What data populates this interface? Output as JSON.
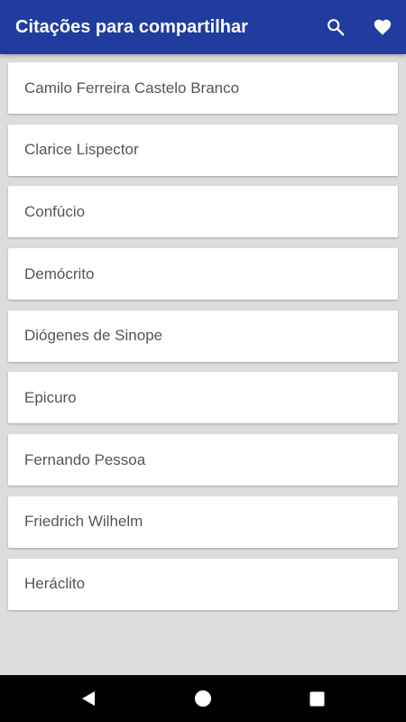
{
  "app_bar": {
    "title": "Citações para compartilhar",
    "background_color": "#1f3c9e",
    "actions": [
      {
        "icon": "search-icon"
      },
      {
        "icon": "heart-icon"
      }
    ]
  },
  "authors": [
    "Camilo Ferreira Castelo Branco",
    "Clarice Lispector",
    "Confúcio",
    "Demócrito",
    "Diógenes de Sinope",
    "Epicuro",
    "Fernando Pessoa",
    "Friedrich Wilhelm",
    "Heráclito"
  ],
  "nav_bar": {
    "buttons": [
      {
        "icon": "back-triangle-icon"
      },
      {
        "icon": "home-circle-icon"
      },
      {
        "icon": "recents-square-icon"
      }
    ]
  }
}
